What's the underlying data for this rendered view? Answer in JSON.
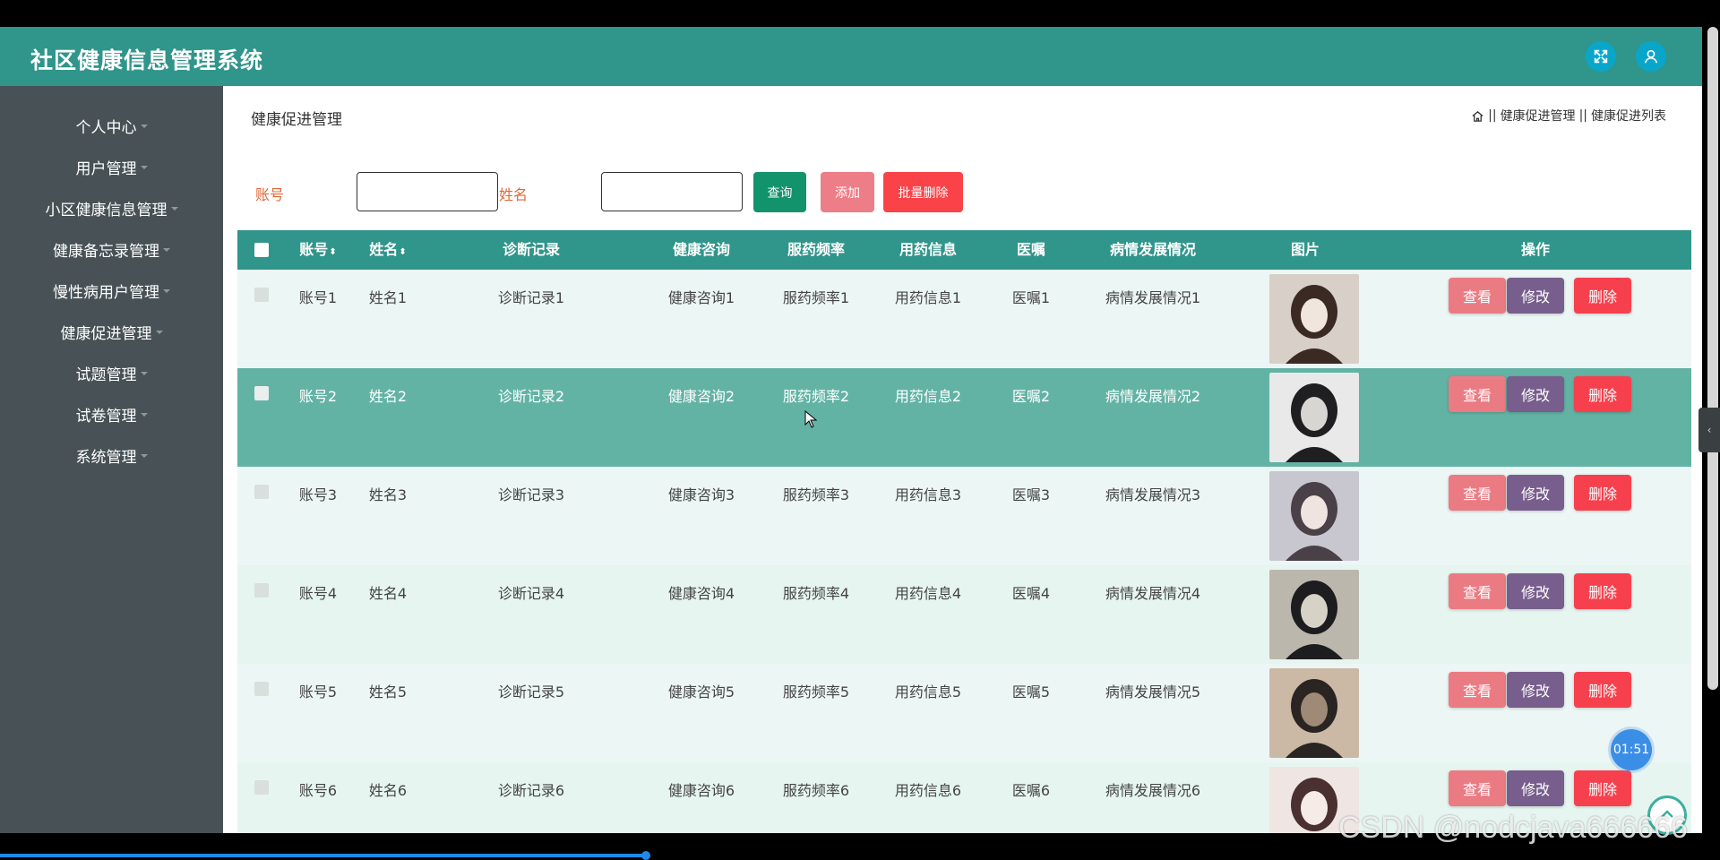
{
  "header": {
    "title": "社区健康信息管理系统",
    "fullscreen_icon": "expand-icon",
    "user_icon": "user-icon",
    "accent": "#30958a"
  },
  "sidebar": {
    "items": [
      {
        "label": "个人中心"
      },
      {
        "label": "用户管理"
      },
      {
        "label": "小区健康信息管理"
      },
      {
        "label": "健康备忘录管理"
      },
      {
        "label": "慢性病用户管理"
      },
      {
        "label": "健康促进管理"
      },
      {
        "label": "试题管理"
      },
      {
        "label": "试卷管理"
      },
      {
        "label": "系统管理"
      }
    ]
  },
  "page": {
    "title": "健康促进管理",
    "breadcrumb": {
      "home_icon": "home-icon",
      "sep": "||",
      "level1": "健康促进管理",
      "level2": "健康促进列表"
    }
  },
  "search": {
    "account_label": "账号",
    "account_value": "",
    "name_label": "姓名",
    "name_value": "",
    "query_label": "查询",
    "add_label": "添加",
    "batch_delete_label": "批量删除"
  },
  "table": {
    "columns": {
      "account": "账号",
      "name": "姓名",
      "diagnosis": "诊断记录",
      "consult": "健康咨询",
      "frequency": "服药频率",
      "medication": "用药信息",
      "advice": "医嘱",
      "progress": "病情发展情况",
      "image": "图片",
      "actions": "操作"
    },
    "action_labels": {
      "view": "查看",
      "edit": "修改",
      "delete": "删除"
    },
    "rows": [
      {
        "account": "账号1",
        "name": "姓名1",
        "diagnosis": "诊断记录1",
        "consult": "健康咨询1",
        "frequency": "服药频率1",
        "medication": "用药信息1",
        "advice": "医嘱1",
        "progress": "病情发展情况1"
      },
      {
        "account": "账号2",
        "name": "姓名2",
        "diagnosis": "诊断记录2",
        "consult": "健康咨询2",
        "frequency": "服药频率2",
        "medication": "用药信息2",
        "advice": "医嘱2",
        "progress": "病情发展情况2",
        "hovered": true
      },
      {
        "account": "账号3",
        "name": "姓名3",
        "diagnosis": "诊断记录3",
        "consult": "健康咨询3",
        "frequency": "服药频率3",
        "medication": "用药信息3",
        "advice": "医嘱3",
        "progress": "病情发展情况3"
      },
      {
        "account": "账号4",
        "name": "姓名4",
        "diagnosis": "诊断记录4",
        "consult": "健康咨询4",
        "frequency": "服药频率4",
        "medication": "用药信息4",
        "advice": "医嘱4",
        "progress": "病情发展情况4"
      },
      {
        "account": "账号5",
        "name": "姓名5",
        "diagnosis": "诊断记录5",
        "consult": "健康咨询5",
        "frequency": "服药频率5",
        "medication": "用药信息5",
        "advice": "医嘱5",
        "progress": "病情发展情况5"
      },
      {
        "account": "账号6",
        "name": "姓名6",
        "diagnosis": "诊断记录6",
        "consult": "健康咨询6",
        "frequency": "服药频率6",
        "medication": "用药信息6",
        "advice": "医嘱6",
        "progress": "病情发展情况6"
      }
    ]
  },
  "overlays": {
    "timer": "01:51",
    "watermark": "CSDN @nodcjava666666",
    "back_to_top_icon": "arrow-up-icon",
    "collapse_icon": "chevron-left-icon"
  },
  "colors": {
    "header_bg": "#30958a",
    "sidebar_bg": "#475156",
    "row_even": "#ecf6f4",
    "row_odd": "#e6f5f0",
    "row_hover": "#63b3a5",
    "view_btn": "#eb7b83",
    "edit_btn": "#785e8c",
    "delete_btn": "#f7404e",
    "query_btn": "#12936c",
    "add_btn": "#ed7d86",
    "batch_btn": "#f94348"
  }
}
